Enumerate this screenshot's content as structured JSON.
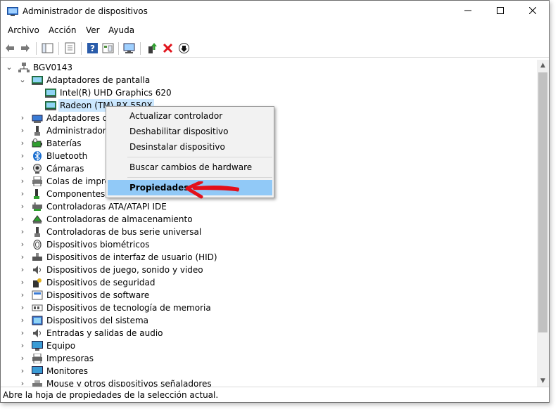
{
  "window": {
    "title": "Administrador de dispositivos",
    "minimize": "—",
    "maximize": "☐",
    "close": "✕"
  },
  "menu": [
    "Archivo",
    "Acción",
    "Ver",
    "Ayuda"
  ],
  "tree": {
    "root": "BGV0143",
    "rows": [
      {
        "level": 1,
        "expanded": true,
        "label": "Adaptadores de pantalla",
        "icon": "display-adapter-icon"
      },
      {
        "level": 2,
        "label": "Intel(R) UHD Graphics 620",
        "icon": "display-adapter-icon"
      },
      {
        "level": 2,
        "label": "Radeon (TM) RX 550X",
        "icon": "display-adapter-icon",
        "selected": true
      },
      {
        "level": 1,
        "label": "Adaptadores de",
        "icon": "network-adapter-icon"
      },
      {
        "level": 1,
        "label": "Administradores",
        "icon": "usb-controller-icon"
      },
      {
        "level": 1,
        "label": "Baterías",
        "icon": "battery-icon"
      },
      {
        "level": 1,
        "label": "Bluetooth",
        "icon": "bluetooth-icon"
      },
      {
        "level": 1,
        "label": "Cámaras",
        "icon": "camera-icon"
      },
      {
        "level": 1,
        "label": "Colas de impres",
        "icon": "printer-queue-icon"
      },
      {
        "level": 1,
        "label": "Componentes de",
        "icon": "software-component-icon"
      },
      {
        "level": 1,
        "label": "Controladoras ATA/ATAPI IDE",
        "icon": "ide-controller-icon"
      },
      {
        "level": 1,
        "label": "Controladoras de almacenamiento",
        "icon": "storage-controller-icon"
      },
      {
        "level": 1,
        "label": "Controladoras de bus serie universal",
        "icon": "usb-controller-icon"
      },
      {
        "level": 1,
        "label": "Dispositivos biométricos",
        "icon": "biometric-icon"
      },
      {
        "level": 1,
        "label": "Dispositivos de interfaz de usuario (HID)",
        "icon": "hid-icon"
      },
      {
        "level": 1,
        "label": "Dispositivos de juego, sonido y video",
        "icon": "sound-icon"
      },
      {
        "level": 1,
        "label": "Dispositivos de seguridad",
        "icon": "security-device-icon"
      },
      {
        "level": 1,
        "label": "Dispositivos de software",
        "icon": "software-device-icon"
      },
      {
        "level": 1,
        "label": "Dispositivos de tecnología de memoria",
        "icon": "memory-technology-icon"
      },
      {
        "level": 1,
        "label": "Dispositivos del sistema",
        "icon": "system-device-icon"
      },
      {
        "level": 1,
        "label": "Entradas y salidas de audio",
        "icon": "audio-io-icon"
      },
      {
        "level": 1,
        "label": "Equipo",
        "icon": "computer-icon"
      },
      {
        "level": 1,
        "label": "Impresoras",
        "icon": "printer-icon"
      },
      {
        "level": 1,
        "label": "Monitores",
        "icon": "monitor-icon"
      },
      {
        "level": 1,
        "label": "Mouse y otros dispositivos señaladores",
        "icon": "mouse-icon"
      }
    ]
  },
  "context_menu": {
    "items": [
      "Actualizar controlador",
      "Deshabilitar dispositivo",
      "Desinstalar dispositivo"
    ],
    "scan": "Buscar cambios de hardware",
    "properties": "Propiedades"
  },
  "status": "Abre la hoja de propiedades de la selección actual.",
  "colors": {
    "selection": "#cce8ff",
    "menu_highlight": "#91c9f7",
    "annotation_arrow": "#e3101a"
  }
}
